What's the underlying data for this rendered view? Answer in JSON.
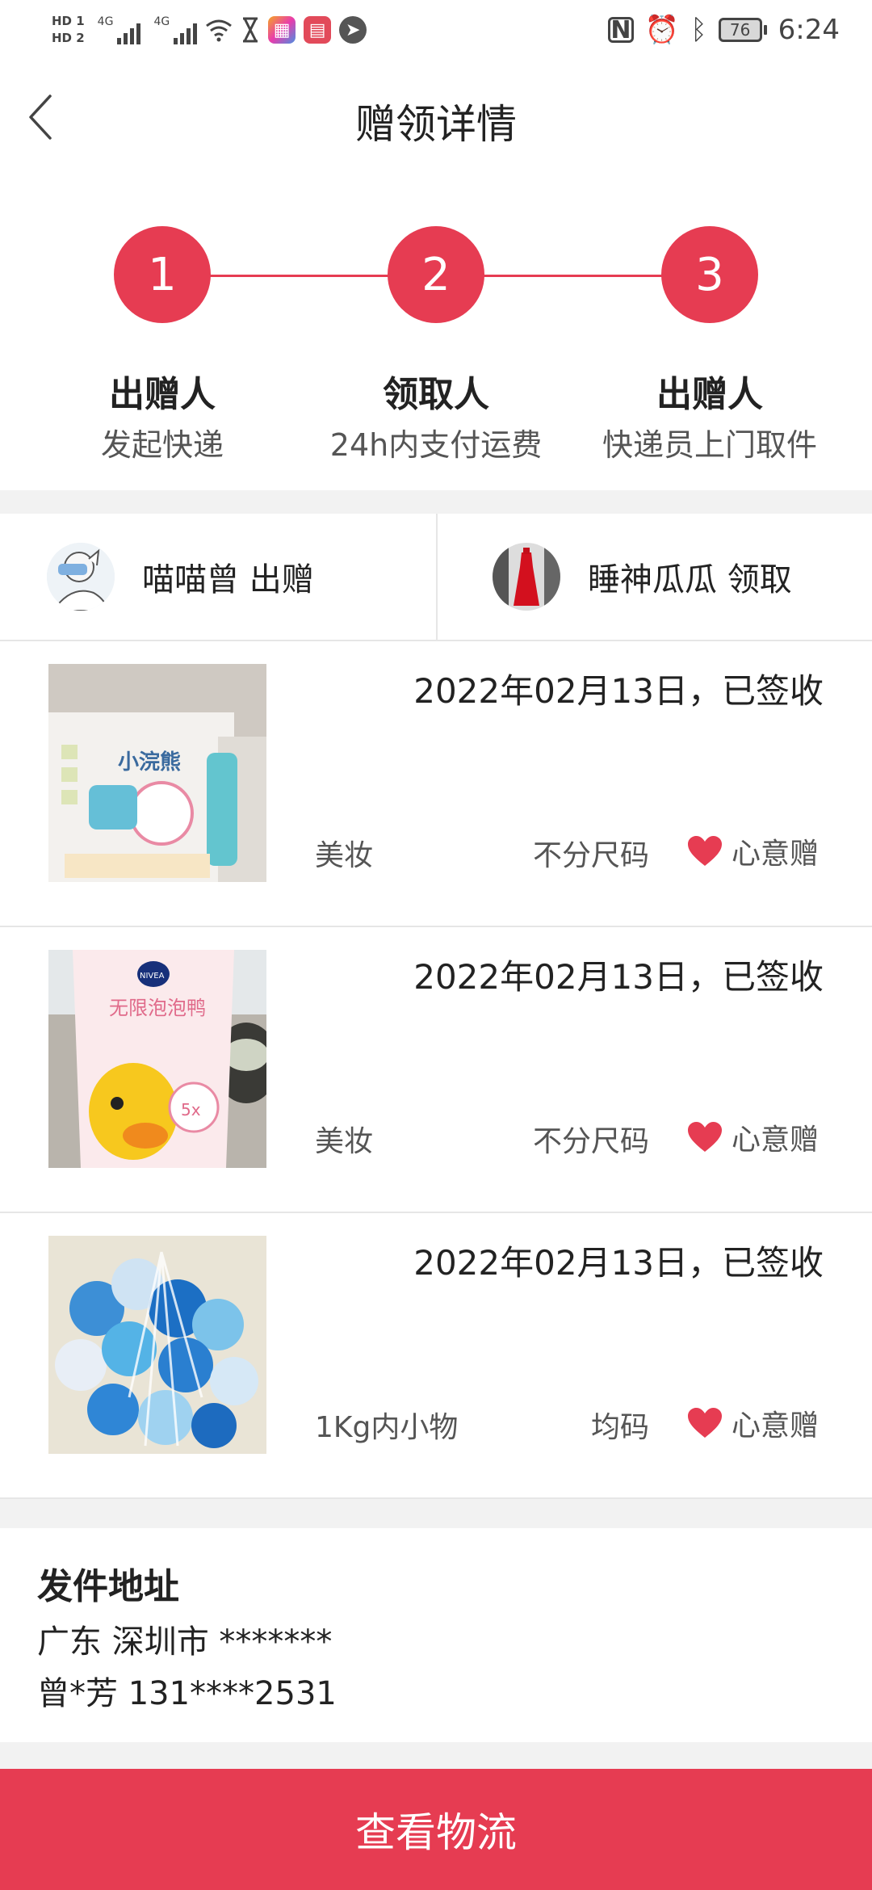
{
  "status_bar": {
    "hd1": "HD 1",
    "hd2": "HD 2",
    "sig1": "4G",
    "sig2": "4G",
    "battery": "76",
    "time": "6:24"
  },
  "header": {
    "title": "赠领详情"
  },
  "steps": [
    {
      "number": "1",
      "title": "出赠人",
      "subtitle": "发起快递"
    },
    {
      "number": "2",
      "title": "领取人",
      "subtitle": "24h内支付运费"
    },
    {
      "number": "3",
      "title": "出赠人",
      "subtitle": "快递员上门取件"
    }
  ],
  "parties": {
    "giver": "喵喵曾 出赠",
    "receiver": "睡神瓜瓜 领取"
  },
  "items": [
    {
      "date": "2022年02月13日，已签收",
      "category": "美妆",
      "size": "不分尺码",
      "gift_type": "心意赠"
    },
    {
      "date": "2022年02月13日，已签收",
      "category": "美妆",
      "size": "不分尺码",
      "gift_type": "心意赠"
    },
    {
      "date": "2022年02月13日，已签收",
      "category": "1Kg内小物",
      "size": "均码",
      "gift_type": "心意赠"
    }
  ],
  "address": {
    "title": "发件地址",
    "line1": "广东 深圳市 *******",
    "line2": "曾*芳 131****2531"
  },
  "button": {
    "label": "查看物流"
  },
  "colors": {
    "accent": "#e63c52",
    "divider": "#e6e6e6",
    "section_gap": "#f2f2f2"
  }
}
